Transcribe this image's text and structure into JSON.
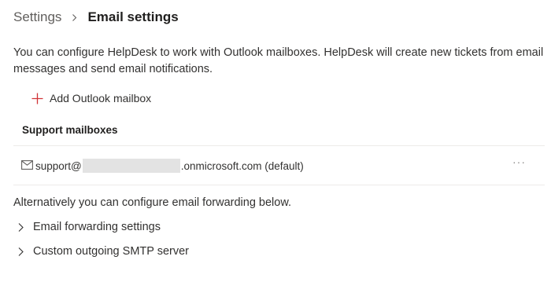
{
  "breadcrumb": {
    "root": "Settings",
    "current": "Email settings"
  },
  "description": "You can configure HelpDesk to work with Outlook mailboxes. HelpDesk will create new tickets from email messages and send email notifications.",
  "add_mailbox": {
    "label": "Add Outlook mailbox",
    "icon": "plus-icon",
    "icon_color": "#d13438"
  },
  "mailboxes": {
    "title": "Support mailboxes",
    "items": [
      {
        "address_prefix": "support@",
        "address_suffix": ".onmicrosoft.com (default)",
        "icon": "mail-icon",
        "more": "···"
      }
    ]
  },
  "alternative_text": "Alternatively you can configure email forwarding below.",
  "expanders": [
    {
      "label": "Email forwarding settings",
      "icon": "chevron-right-icon"
    },
    {
      "label": "Custom outgoing SMTP server",
      "icon": "chevron-right-icon"
    }
  ]
}
